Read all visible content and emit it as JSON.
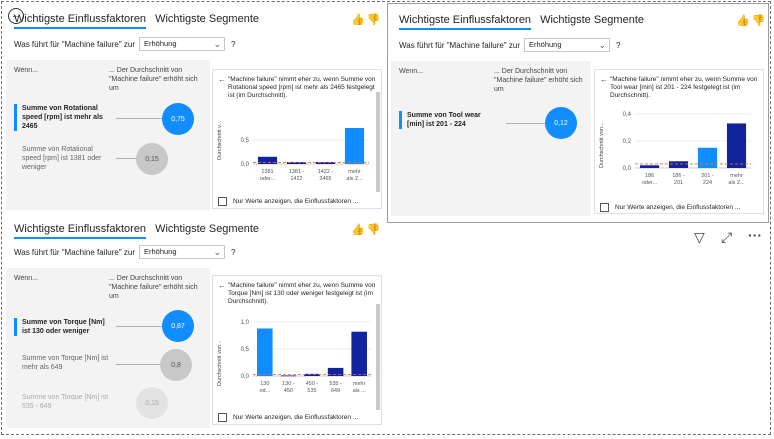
{
  "visuals": [
    {
      "tabs": [
        "Wichtigste Einflussfaktoren",
        "Wichtigste Segmente"
      ],
      "question_prefix": "Was führt für \"Machine failure\" zur",
      "select_value": "Erhöhung",
      "question_mark": "?",
      "col_left": "Wenn...",
      "col_right": "... Der Durchschnitt von \"Machine failure\" erhöht sich um",
      "items": [
        {
          "label": "Summe von Rotational speed [rpm] ist mehr als 2465",
          "value": "0,75"
        },
        {
          "label": "Summe von Rotational speed [rpm] ist 1381 oder weniger",
          "value": "0,15"
        }
      ],
      "detail_text": "\"Machine failure\" nimmt eher zu, wenn Summe von Rotational speed [rpm] ist mehr als 2465 festgelegt ist (im Durchschnitt).",
      "y_axis_label": "Durchschnitt v...",
      "y_ticks": [
        "0,5",
        "0,0"
      ],
      "checkbox_label": "Nur Werte anzeigen, die Einflussfaktoren ..."
    },
    {
      "tabs": [
        "Wichtigste Einflussfaktoren",
        "Wichtigste Segmente"
      ],
      "question_prefix": "Was führt für \"Machine failure\" zur",
      "select_value": "Erhöhung",
      "question_mark": "?",
      "col_left": "Wenn...",
      "col_right": "... Der Durchschnitt von \"Machine failure\" erhöht sich um",
      "items": [
        {
          "label": "Summe von Tool wear [min] ist 201 - 224",
          "value": "0,12"
        }
      ],
      "detail_text": "\"Machine failure\" nimmt eher zu, wenn Summe von Tool wear [min] ist 201 - 224 festgelegt ist (im Durchschnitt).",
      "y_axis_label": "Durchschnitt von...",
      "y_ticks": [
        "0,4",
        "0,2",
        "0,0"
      ],
      "checkbox_label": "Nur Werte anzeigen, die Einflussfaktoren ..."
    },
    {
      "tabs": [
        "Wichtigste Einflussfaktoren",
        "Wichtigste Segmente"
      ],
      "question_prefix": "Was führt für \"Machine failure\" zur",
      "select_value": "Erhöhung",
      "question_mark": "?",
      "col_left": "Wenn...",
      "col_right": "... Der Durchschnitt von \"Machine failure\" erhöht sich um",
      "items": [
        {
          "label": "Summe von Torque [Nm] ist 130 oder weniger",
          "value": "0,87"
        },
        {
          "label": "Summe von Torque [Nm] ist mehr als 649",
          "value": "0,8"
        },
        {
          "label": "Summe von Torque [Nm] ist 535 - 649",
          "value": "0,15"
        }
      ],
      "detail_text": "\"Machine failure\" nimmt eher zu, wenn Summe von Torque [Nm] ist 130 oder weniger festgelegt ist (im Durchschnitt).",
      "y_axis_label": "Durchschnitt von...",
      "y_ticks": [
        "1,0",
        "0,5",
        "0,0"
      ],
      "checkbox_label": "Nur Werte anzeigen, die Einflussfaktoren ..."
    }
  ],
  "chart_data": [
    {
      "type": "bar",
      "categories": [
        [
          "1381",
          "oder..."
        ],
        [
          "1381 -",
          "1422"
        ],
        [
          "1422 -",
          "2465"
        ],
        [
          "mehr",
          "als 2..."
        ]
      ],
      "values": [
        0.15,
        0.04,
        0.04,
        0.75
      ],
      "ylim": [
        0,
        1.0
      ],
      "colors": [
        "#12239e",
        "#12239e",
        "#12239e",
        "#118dff"
      ],
      "average_line": 0.03
    },
    {
      "type": "bar",
      "categories": [
        [
          "186",
          "oder..."
        ],
        [
          "186 -",
          "201"
        ],
        [
          "201 -",
          "224"
        ],
        [
          "mehr",
          "als 2..."
        ]
      ],
      "values": [
        0.02,
        0.05,
        0.15,
        0.33
      ],
      "ylim": [
        0,
        0.4
      ],
      "colors": [
        "#12239e",
        "#12239e",
        "#118dff",
        "#12239e"
      ],
      "average_line": 0.03
    },
    {
      "type": "bar",
      "categories": [
        [
          "130",
          "od..."
        ],
        [
          "130 -",
          "450"
        ],
        [
          "450 -",
          "535"
        ],
        [
          "535 -",
          "649"
        ],
        [
          "mehr",
          "als ..."
        ]
      ],
      "values": [
        0.88,
        0.01,
        0.04,
        0.15,
        0.82
      ],
      "ylim": [
        0,
        1.0
      ],
      "colors": [
        "#118dff",
        "#12239e",
        "#12239e",
        "#12239e",
        "#12239e"
      ],
      "average_line": 0.03
    }
  ],
  "thumbs": "👍👎",
  "toolbar": {
    "filter": "▽",
    "focus": "⤢",
    "more": "···"
  },
  "back_button": "←"
}
